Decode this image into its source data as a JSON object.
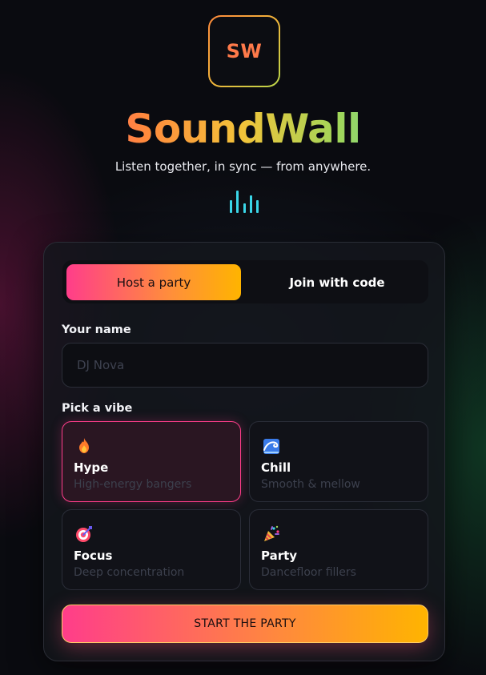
{
  "logo": {
    "initials": "SW"
  },
  "brand": {
    "name": "SoundWall",
    "tagline": "Listen together, in sync — from anywhere."
  },
  "tabs": [
    {
      "label": "Host a party",
      "active": true
    },
    {
      "label": "Join with code",
      "active": false
    }
  ],
  "form": {
    "name_label": "Your name",
    "name_placeholder": "DJ Nova",
    "name_value": "",
    "vibe_label": "Pick a vibe",
    "vibes": [
      {
        "icon": "fire-icon",
        "name": "Hype",
        "desc": "High-energy bangers",
        "selected": true
      },
      {
        "icon": "wave-icon",
        "name": "Chill",
        "desc": "Smooth & mellow",
        "selected": false
      },
      {
        "icon": "target-icon",
        "name": "Focus",
        "desc": "Deep concentration",
        "selected": false
      },
      {
        "icon": "party-popper-icon",
        "name": "Party",
        "desc": "Dancefloor fillers",
        "selected": false
      }
    ],
    "submit_label": "START THE PARTY"
  },
  "colors": {
    "accent_pink": "#ff3d8a",
    "accent_orange": "#ff8a3c",
    "accent_yellow": "#ffb400",
    "accent_cyan": "#3ad6e8",
    "background": "#0a0b10"
  }
}
